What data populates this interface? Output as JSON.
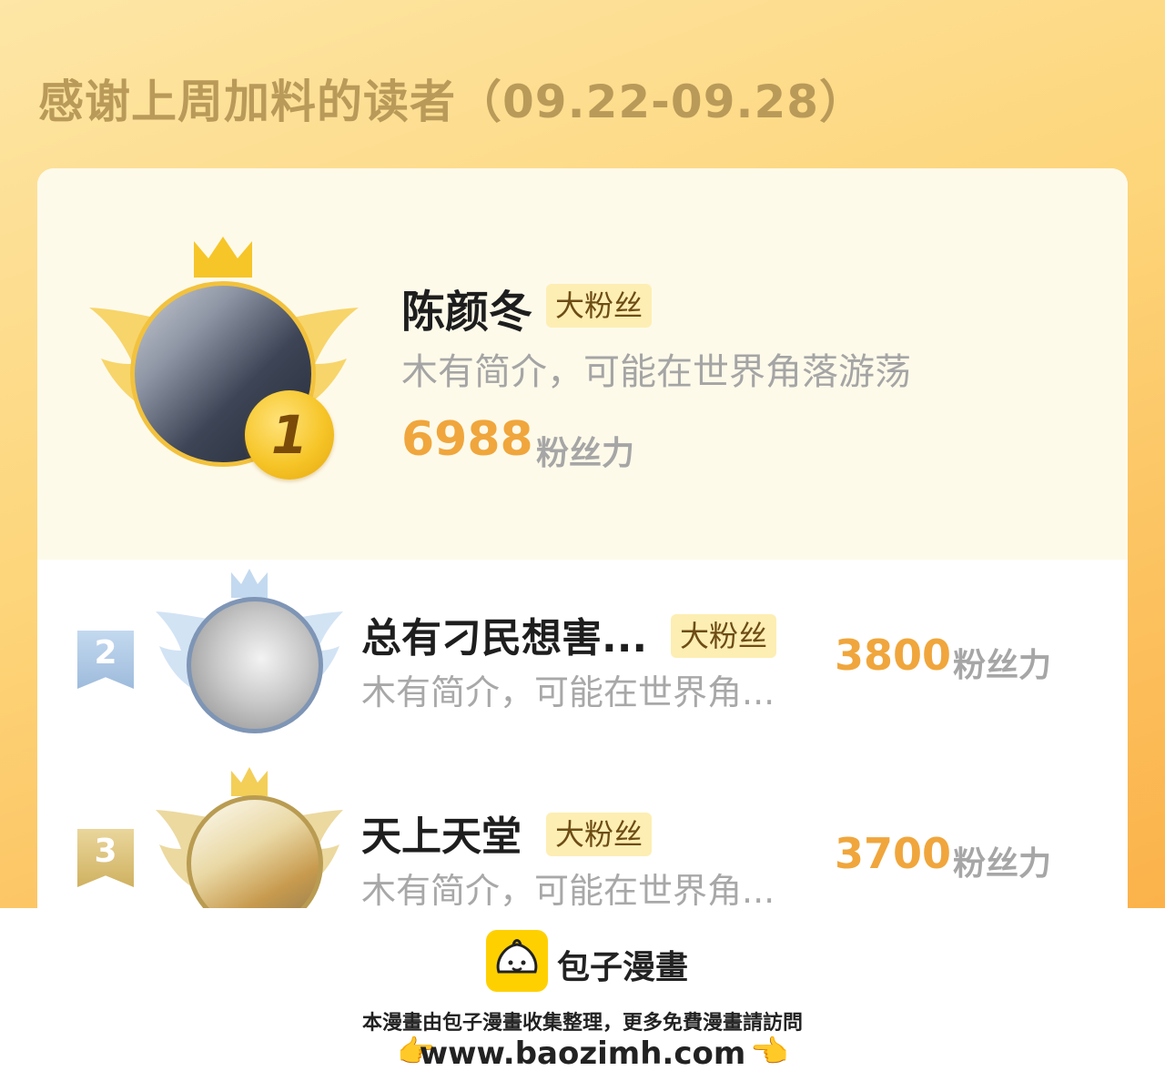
{
  "page_title": "感谢上周加料的读者（09.22-09.28）",
  "first_place": {
    "rank": "1",
    "name": "陈颜冬",
    "badge": "大粉丝",
    "description": "木有简介，可能在世界角落游荡",
    "score": "6988",
    "score_unit": "粉丝力"
  },
  "rows": [
    {
      "rank": "2",
      "name": "总有刁民想害...",
      "badge": "大粉丝",
      "description": "木有简介，可能在世界角...",
      "score": "3800",
      "score_unit": "粉丝力"
    },
    {
      "rank": "3",
      "name": "天上天堂",
      "badge": "大粉丝",
      "description": "木有简介，可能在世界角...",
      "score": "3700",
      "score_unit": "粉丝力"
    }
  ],
  "footer": {
    "app_name": "包子漫畫",
    "note": "本漫畫由包子漫畫收集整理，更多免費漫畫請訪問",
    "url": "www.baozimh.com",
    "hand_left": "👉",
    "hand_right": "👈"
  },
  "icons": {
    "crown": "crown-icon",
    "wings": "wings-icon",
    "logo": "bun-logo-icon"
  },
  "colors": {
    "accent": "#f0a63c",
    "title": "#b99a59",
    "gold": "#f2c23e",
    "silver": "#9ebbdc",
    "bronze": "#cfb160"
  }
}
